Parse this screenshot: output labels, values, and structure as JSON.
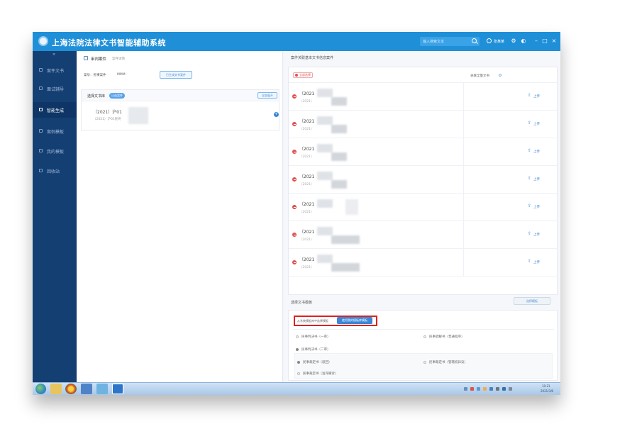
{
  "app": {
    "title": "上海法院法律文书智能辅助系统",
    "search_placeholder": "输入搜索文本",
    "user_name": "张某某"
  },
  "sidebar": {
    "toggle": "≡",
    "items": [
      {
        "label": "案件文书",
        "active": false
      },
      {
        "label": "面试辅导",
        "active": false
      },
      {
        "label": "智能生成",
        "active": true
      },
      {
        "label": "案例模板",
        "active": false
      },
      {
        "label": "我的模板",
        "active": false
      },
      {
        "label": "回收站",
        "active": false
      }
    ]
  },
  "left_panel": {
    "case_title": "审判案件",
    "case_subtitle": "案件详情",
    "case_no_label": "案号：民事案件",
    "case_no_value": "MMM",
    "case_action": "已生成文书案件",
    "card_title": "选择文书库",
    "card_badge": "已选案件",
    "card_btn": "全部展开",
    "item_no": "（2021）沪01",
    "item_sub": "（2021）沪01民终",
    "expand_icon": "+"
  },
  "right_panel": {
    "section_title": "案件关联基本文书信息案件",
    "select_all": "全部选择",
    "col_header": "关联全量文书",
    "rows": [
      {
        "no": "（2021",
        "sub": "（2021）",
        "action": "上传"
      },
      {
        "no": "（2021",
        "sub": "（2021）",
        "action": "上传"
      },
      {
        "no": "（2021",
        "sub": "（2021）",
        "action": "上传"
      },
      {
        "no": "（2021",
        "sub": "（2021）",
        "action": "上传"
      },
      {
        "no": "（2021",
        "sub": "（2021）",
        "action": "上传"
      },
      {
        "no": "（2021",
        "sub": "（2021）",
        "action": "上传"
      },
      {
        "no": "（2021",
        "sub": "（2021）",
        "action": "上传"
      }
    ],
    "template": {
      "title": "选择文书模板",
      "select_btn": "选择模板",
      "tab_1": "从系统模板库中选择模板",
      "tab_2": "使用我的模板库模板",
      "options": [
        {
          "label": "民事判决书（一审）",
          "filled": false
        },
        {
          "label": "民事调解书（普通程序）",
          "filled": false
        },
        {
          "label": "民事判决书（二审）",
          "filled": true
        },
        {
          "label": "民事裁定书（驳回）",
          "filled": true
        },
        {
          "label": "民事裁定书（管辖权异议）",
          "filled": false
        },
        {
          "label": "民事裁定书（准许撤诉）",
          "filled": false
        }
      ]
    }
  },
  "taskbar": {
    "time": "10:21",
    "date": "2021/3/8"
  },
  "colors": {
    "titlebar": "#1f8fd8",
    "sidebar": "#143f72",
    "accent": "#3a86d8",
    "highlight_outline": "#e02020"
  }
}
